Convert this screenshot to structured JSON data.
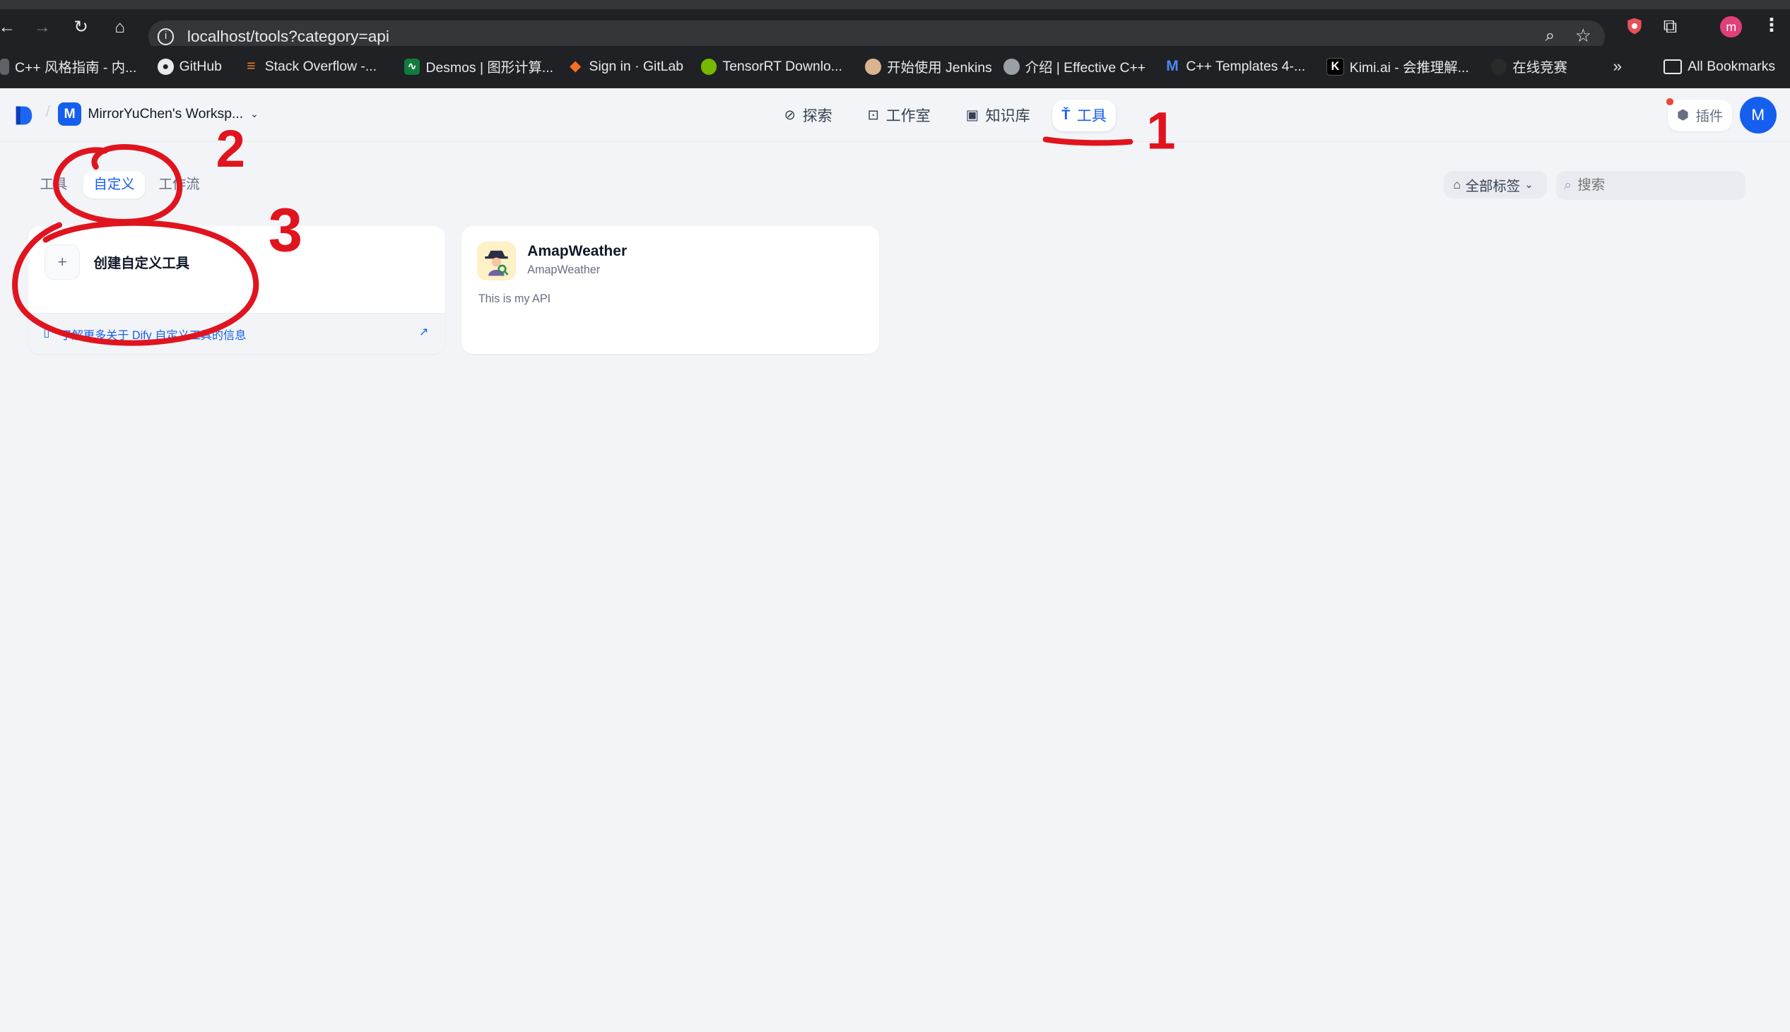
{
  "browser": {
    "url": "localhost/tools?category=api",
    "profile_initial": "m",
    "bookmarks": [
      {
        "label": "C++ 风格指南 - 内..."
      },
      {
        "label": "GitHub"
      },
      {
        "label": "Stack Overflow -..."
      },
      {
        "label": "Desmos | 图形计算..."
      },
      {
        "label": "Sign in · GitLab"
      },
      {
        "label": "TensorRT Downlo..."
      },
      {
        "label": "开始使用 Jenkins"
      },
      {
        "label": "介绍 | Effective C++"
      },
      {
        "label": "C++ Templates 4-..."
      },
      {
        "label": "Kimi.ai - 会推理解..."
      },
      {
        "label": "在线竞赛"
      }
    ],
    "all_bookmarks": "All Bookmarks"
  },
  "app": {
    "workspace_initial": "M",
    "workspace_name": "MirrorYuChen's Worksp...",
    "nav": [
      {
        "label": "探索"
      },
      {
        "label": "工作室"
      },
      {
        "label": "知识库"
      },
      {
        "label": "工具"
      }
    ],
    "plugins_label": "插件",
    "user_initial": "M"
  },
  "tools_page": {
    "tabs": [
      {
        "label": "工具"
      },
      {
        "label": "自定义"
      },
      {
        "label": "工作流"
      }
    ],
    "tag_filter": "全部标签",
    "search_placeholder": "搜索",
    "create_card": {
      "title": "创建自定义工具",
      "link": "了解更多关于 Dify 自定义工具的信息"
    },
    "tool_card": {
      "name": "AmapWeather",
      "author": "AmapWeather",
      "description": "This is my API"
    }
  },
  "annotations": [
    "1",
    "2",
    "3"
  ],
  "colors": {
    "accent": "#155eef",
    "annotation": "#e0141e",
    "browser_bg": "#202124"
  }
}
